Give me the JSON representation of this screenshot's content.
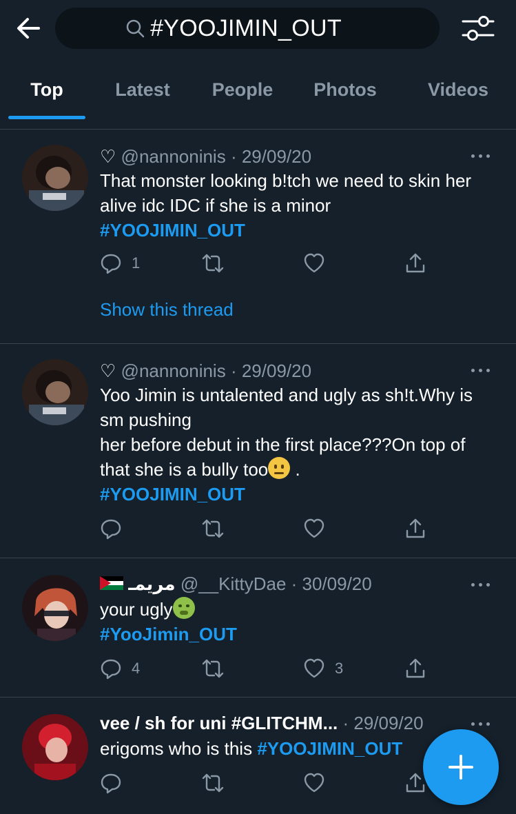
{
  "search": {
    "query": "#YOOJIMIN_OUT"
  },
  "tabs": [
    {
      "label": "Top",
      "active": true
    },
    {
      "label": "Latest"
    },
    {
      "label": "People"
    },
    {
      "label": "Photos"
    },
    {
      "label": "Videos"
    }
  ],
  "colors": {
    "background": "#15202b",
    "accent": "#1d9bf0",
    "muted": "#8b98a5",
    "divider": "#38444d"
  },
  "tweets": [
    {
      "handle": "@nannoninis",
      "date": "· 29/09/20",
      "text": "That monster looking b!tch we need to skin her alive idc IDC if she is a minor",
      "hashtag": "#YOOJIMIN_OUT",
      "reply_count": "1",
      "like_count": "",
      "thread_link": "Show this thread"
    },
    {
      "handle": "@nannoninis",
      "date": "· 29/09/20",
      "text_line1": "Yoo Jimin is untalented and ugly as sh!t.Why is sm pushing",
      "text_line2": "her before debut in the first place???On top of that she is a bully too",
      "text_end": ".",
      "hashtag": "#YOOJIMIN_OUT"
    },
    {
      "display_name": "مريمـ",
      "handle": "@__KittyDae",
      "date": "· 30/09/20",
      "text": "your ugly",
      "hashtag": "#YooJimin_OUT",
      "reply_count": "4",
      "like_count": "3"
    },
    {
      "display_name": "vee / sh for uni #GLITCHM...",
      "date": "· 29/09/20",
      "text": "erigoms who is this",
      "hashtag": "#YOOJIMIN_OUT"
    }
  ],
  "icons": {
    "back": "arrow-left-icon",
    "search": "search-icon",
    "filter": "sliders-icon",
    "reply": "reply-icon",
    "retweet": "retweet-icon",
    "like": "heart-icon",
    "share": "share-icon",
    "compose": "plus-icon"
  }
}
